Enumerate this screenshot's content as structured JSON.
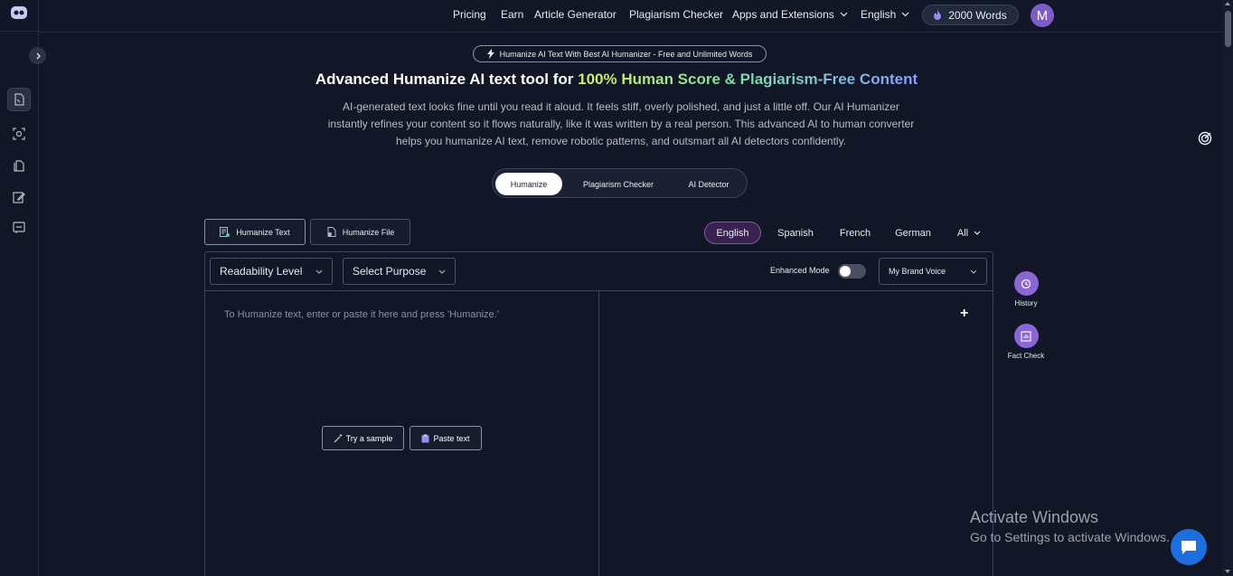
{
  "nav": {
    "items": [
      "Pricing",
      "Earn",
      "Article Generator",
      "Plagiarism Checker",
      "Apps and Extensions",
      "English"
    ],
    "words": "2000 Words",
    "avatar_initial": "M"
  },
  "hero": {
    "badge": "Humanize AI Text With Best AI Humanizer - Free and Unlimited Words",
    "title_plain": "Advanced Humanize AI text tool for ",
    "title_highlight": "100% Human Score & Plagiarism-Free Content",
    "description": "AI-generated text looks fine until you read it aloud. It feels stiff, overly polished, and just a little off. Our AI Humanizer instantly refines your content so it flows naturally, like it was written by a real person. This advanced AI to human converter helps you humanize AI text, remove robotic patterns, and outsmart all AI detectors confidently."
  },
  "mode_tabs": [
    "Humanize",
    "Plagiarism Checker",
    "AI Detector"
  ],
  "tool_tabs": [
    "Humanize Text",
    "Humanize File"
  ],
  "languages": [
    "English",
    "Spanish",
    "French",
    "German",
    "All"
  ],
  "editor": {
    "readability": "Readability Level",
    "purpose": "Select Purpose",
    "enhanced_mode": "Enhanced Mode",
    "brand_voice": "My Brand Voice",
    "placeholder": "To Humanize text, enter or paste it here and press 'Humanize.'",
    "try_sample": "Try a sample",
    "paste_text": "Paste text",
    "plus": "+"
  },
  "side_actions": [
    "History",
    "Fact Check"
  ],
  "watermark": {
    "line1": "Activate Windows",
    "line2": "Go to Settings to activate Windows."
  },
  "colors": {
    "background": "#121728",
    "accent_purple": "#8a66d6",
    "chat_blue": "#1d6fe0"
  }
}
